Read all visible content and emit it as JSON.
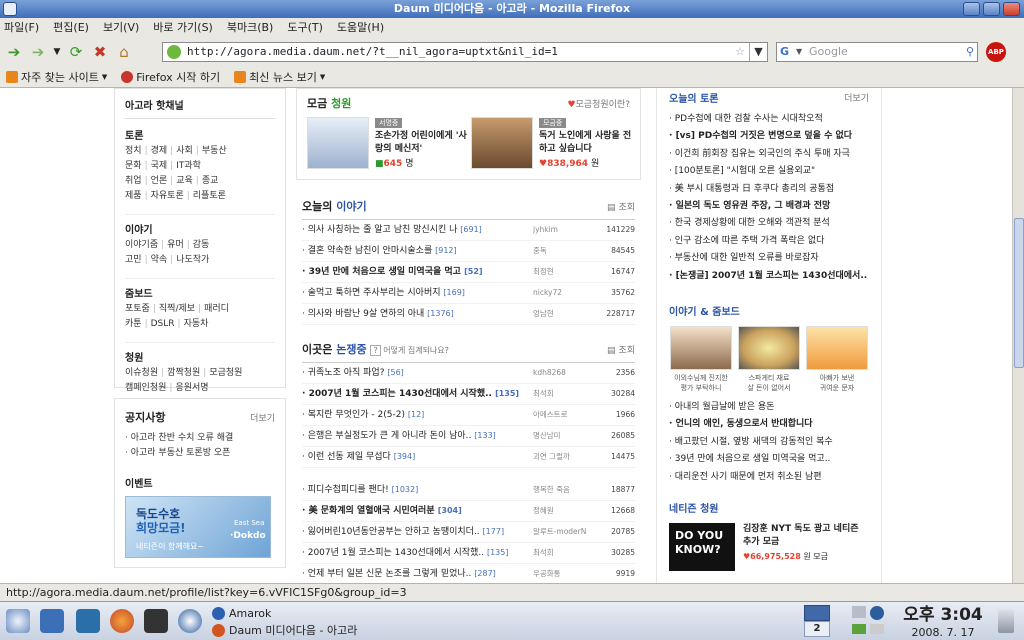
{
  "window": {
    "title": "Daum 미디어다음 - 아고라 - Mozilla Firefox"
  },
  "menubar": [
    "파일(F)",
    "편집(E)",
    "보기(V)",
    "바로 가기(S)",
    "북마크(B)",
    "도구(T)",
    "도움말(H)"
  ],
  "navbar": {
    "url": "http://agora.media.daum.net/?t__nil_agora=uptxt&nil_id=1",
    "search_placeholder": "Google",
    "search_engine_glyph": "G",
    "abp_label": "ABP"
  },
  "bookmarks": [
    {
      "label": "자주 찾는 사이트",
      "dropdown": true
    },
    {
      "label": "Firefox 시작 하기",
      "dropdown": false
    },
    {
      "label": "최신 뉴스 보기",
      "dropdown": true
    }
  ],
  "left": {
    "header": "아고라 핫채널",
    "sections": [
      {
        "title": "토론",
        "rows": [
          [
            "정치",
            "경제",
            "사회",
            "부동산"
          ],
          [
            "문화",
            "국제",
            "IT과학"
          ],
          [
            "취업",
            "언론",
            "교육",
            "종교"
          ],
          [
            "제품",
            "자유토론",
            "리플토론"
          ]
        ]
      },
      {
        "title": "이야기",
        "rows": [
          [
            "이야기줌",
            "유머",
            "감동"
          ],
          [
            "고민",
            "약속",
            "나도작가"
          ]
        ]
      },
      {
        "title": "줌보드",
        "rows": [
          [
            "포토줌",
            "직찍/제보",
            "패러디"
          ],
          [
            "카툰",
            "DSLR",
            "자동차"
          ]
        ]
      },
      {
        "title": "청원",
        "rows": [
          [
            "이슈청원",
            "깜짝청원",
            "모금청원"
          ],
          [
            "캠페인청원",
            "응원서명"
          ]
        ]
      }
    ],
    "notice": {
      "title": "공지사항",
      "more": "더보기",
      "items": [
        "아고라 찬반 수치 오류 해결",
        "아고라 부동산 토론방 오픈"
      ]
    },
    "event": {
      "title": "이벤트",
      "banner_line1": "독도수호",
      "banner_line2": "희망모금!",
      "banner_line3": "네티즌이 함께해요~",
      "banner_tag1": "East Sea",
      "banner_tag2": "Dokdo"
    }
  },
  "mid": {
    "fundraising": {
      "title_a": "모금",
      "title_b": "청원",
      "help": "모금청원이란?",
      "items": [
        {
          "badge": "서명중",
          "title": "조손가정 어린이에게 '사랑의 메신저'",
          "count": "645",
          "unit": "명"
        },
        {
          "badge": "모금중",
          "title": "독거 노인에게 사랑을 전하고 싶습니다",
          "count": "838,964",
          "unit": "원"
        }
      ]
    },
    "stories": {
      "title_a": "오늘의",
      "title_b": "이야기",
      "view_label": "조회",
      "rows": [
        {
          "title": "의사 사칭하는 줄 알고 남친 망신시킨 나",
          "count": "[691]",
          "author": "jyhkim",
          "views": "141229",
          "bold": false
        },
        {
          "title": "결혼 약속한 남친이 안마시술소를",
          "count": "[912]",
          "author": "중독",
          "views": "84545",
          "bold": false
        },
        {
          "title": "39년 만에 처음으로 생일 미역국을 먹고",
          "count": "[52]",
          "author": "최정현",
          "views": "16747",
          "bold": true
        },
        {
          "title": "술먹고 툭하면 주사부리는 시아버지",
          "count": "[169]",
          "author": "nicky72",
          "views": "35762",
          "bold": false
        },
        {
          "title": "의사와 바람난 9살 연하의 아내",
          "count": "[1376]",
          "author": "엉남현",
          "views": "228717",
          "bold": false
        }
      ]
    },
    "debates": {
      "title_a": "이곳은",
      "title_b": "논쟁중",
      "help": "어떻게 집계되나요?",
      "view_label": "조회",
      "rows": [
        {
          "title": "귀족노조 아직 파업?",
          "count": "[56]",
          "author": "kdh8268",
          "views": "2356",
          "bold": false
        },
        {
          "title": "2007년 1월 코스피는 1430선대에서 시작했..",
          "count": "[135]",
          "author": "최석희",
          "views": "30284",
          "bold": true
        },
        {
          "title": "복지란 무엇인가 - 2(5-2)",
          "count": "[12]",
          "author": "아메스트로",
          "views": "1966",
          "bold": false
        },
        {
          "title": "은행은 부실정도가 큰 게 아니라 돈이 남아..",
          "count": "[133]",
          "author": "명산남미",
          "views": "26085",
          "bold": false
        },
        {
          "title": "이런 선동 제일 무섭다",
          "count": "[394]",
          "author": "괴연 그럴까",
          "views": "14475",
          "bold": false
        }
      ],
      "rows2": [
        {
          "title": "피디수첩피디를 팬다!",
          "count": "[1032]",
          "author": "행복한 죽음",
          "views": "18877",
          "bold": false
        },
        {
          "title": "美 문화계의 열혈애국 시민여러분",
          "count": "[304]",
          "author": "정혜원",
          "views": "12668",
          "bold": true
        },
        {
          "title": "잃어버린10년동안공부는 안하고 농땡이치더..",
          "count": "[177]",
          "author": "알루트-moderN",
          "views": "20785",
          "bold": false
        },
        {
          "title": "2007년 1월 코스피는 1430선대에서 시작했..",
          "count": "[135]",
          "author": "최석희",
          "views": "30285",
          "bold": false
        },
        {
          "title": "언제 부터 일본 신문 논조를 그렇게 믿었나..",
          "count": "[287]",
          "author": "우공화통",
          "views": "9919",
          "bold": false
        }
      ]
    }
  },
  "right": {
    "debate": {
      "title": "오늘의 토론",
      "more": "더보기",
      "items": [
        {
          "text": "PD수첩에 대한 검찰 수사는 시대착오적",
          "bold": false
        },
        {
          "text": "[vs] PD수첩의 거짓은 변명으로 덮을 수 없다",
          "bold": true
        },
        {
          "text": "이건희 前회장 집유는 외국인의 주식 투매 자극",
          "bold": false
        },
        {
          "text": "[100분토론] \"시험대 오른 실용외교\"",
          "bold": false
        },
        {
          "text": "美 부시 대통령과 日 후쿠다 총리의 공통점",
          "bold": false
        },
        {
          "text": "일본의 독도 영유권 주장, 그 배경과 전망",
          "bold": true
        },
        {
          "text": "한국 경제상황에 대한 오해와 객관적 분석",
          "bold": false
        },
        {
          "text": "인구 감소에 따른 주택 가격 폭락은 없다",
          "bold": false
        },
        {
          "text": "부동산에 대한 일반적 오류를 바로잡자",
          "bold": false
        },
        {
          "text": "[논쟁글] 2007년 1월 코스피는 1430선대에서..",
          "bold": true
        }
      ]
    },
    "story_board": {
      "title": "이야기 & 줌보드",
      "thumbs": [
        {
          "caption1": "이외수님께 진지한",
          "caption2": "평가 부탁하니"
        },
        {
          "caption1": "스파게티 재료",
          "caption2": "살 돈이 없어서"
        },
        {
          "caption1": "아빠가 보낸",
          "caption2": "귀여운 문자"
        }
      ],
      "items": [
        {
          "text": "아내의 월급날에 받은 용돈",
          "bold": false
        },
        {
          "text": "언니의 애인, 동생으로서 반대합니다",
          "bold": true
        },
        {
          "text": "배고팠던 시절, 옆방 새댁의 감동적인 복수",
          "bold": false
        },
        {
          "text": "39년 만에 처음으로 생일 미역국을 먹고..",
          "bold": false
        },
        {
          "text": "대리운전 사기 때문에 먼저 취소된 남편",
          "bold": false
        }
      ]
    },
    "netizen": {
      "title": "네티즌 청원",
      "ad_line1": "DO YOU",
      "ad_line2": "KNOW?",
      "text": "김장훈 NYT 독도 광고 네티즌 추가 모금",
      "amount": "66,975,528",
      "unit": "원 모금"
    }
  },
  "statusbar": {
    "text": "http://agora.media.daum.net/profile/list?key=6.vVFIC1SFg0&group_id=3"
  },
  "taskbar": {
    "tasks": [
      "Amarok",
      "Daum 미디어다음 - 아고라"
    ],
    "desktop_number": "2",
    "time": "오후 3:04",
    "date": "2008. 7. 17"
  },
  "colors": {
    "accent_blue": "#2b55a6",
    "petition_green": "#2e9a2e",
    "heart_red": "#e5432f"
  }
}
